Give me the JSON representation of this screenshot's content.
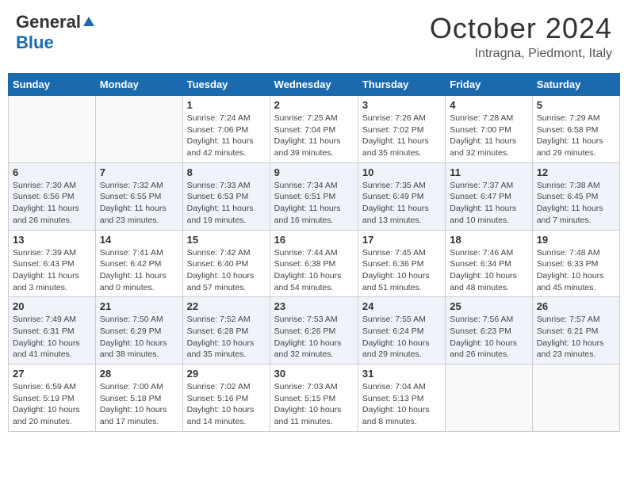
{
  "header": {
    "logo_general": "General",
    "logo_blue": "Blue",
    "month_title": "October 2024",
    "location": "Intragna, Piedmont, Italy"
  },
  "calendar": {
    "days_of_week": [
      "Sunday",
      "Monday",
      "Tuesday",
      "Wednesday",
      "Thursday",
      "Friday",
      "Saturday"
    ],
    "weeks": [
      [
        {
          "day": "",
          "info": ""
        },
        {
          "day": "",
          "info": ""
        },
        {
          "day": "1",
          "info": "Sunrise: 7:24 AM\nSunset: 7:06 PM\nDaylight: 11 hours and 42 minutes."
        },
        {
          "day": "2",
          "info": "Sunrise: 7:25 AM\nSunset: 7:04 PM\nDaylight: 11 hours and 39 minutes."
        },
        {
          "day": "3",
          "info": "Sunrise: 7:26 AM\nSunset: 7:02 PM\nDaylight: 11 hours and 35 minutes."
        },
        {
          "day": "4",
          "info": "Sunrise: 7:28 AM\nSunset: 7:00 PM\nDaylight: 11 hours and 32 minutes."
        },
        {
          "day": "5",
          "info": "Sunrise: 7:29 AM\nSunset: 6:58 PM\nDaylight: 11 hours and 29 minutes."
        }
      ],
      [
        {
          "day": "6",
          "info": "Sunrise: 7:30 AM\nSunset: 6:56 PM\nDaylight: 11 hours and 26 minutes."
        },
        {
          "day": "7",
          "info": "Sunrise: 7:32 AM\nSunset: 6:55 PM\nDaylight: 11 hours and 23 minutes."
        },
        {
          "day": "8",
          "info": "Sunrise: 7:33 AM\nSunset: 6:53 PM\nDaylight: 11 hours and 19 minutes."
        },
        {
          "day": "9",
          "info": "Sunrise: 7:34 AM\nSunset: 6:51 PM\nDaylight: 11 hours and 16 minutes."
        },
        {
          "day": "10",
          "info": "Sunrise: 7:35 AM\nSunset: 6:49 PM\nDaylight: 11 hours and 13 minutes."
        },
        {
          "day": "11",
          "info": "Sunrise: 7:37 AM\nSunset: 6:47 PM\nDaylight: 11 hours and 10 minutes."
        },
        {
          "day": "12",
          "info": "Sunrise: 7:38 AM\nSunset: 6:45 PM\nDaylight: 11 hours and 7 minutes."
        }
      ],
      [
        {
          "day": "13",
          "info": "Sunrise: 7:39 AM\nSunset: 6:43 PM\nDaylight: 11 hours and 3 minutes."
        },
        {
          "day": "14",
          "info": "Sunrise: 7:41 AM\nSunset: 6:42 PM\nDaylight: 11 hours and 0 minutes."
        },
        {
          "day": "15",
          "info": "Sunrise: 7:42 AM\nSunset: 6:40 PM\nDaylight: 10 hours and 57 minutes."
        },
        {
          "day": "16",
          "info": "Sunrise: 7:44 AM\nSunset: 6:38 PM\nDaylight: 10 hours and 54 minutes."
        },
        {
          "day": "17",
          "info": "Sunrise: 7:45 AM\nSunset: 6:36 PM\nDaylight: 10 hours and 51 minutes."
        },
        {
          "day": "18",
          "info": "Sunrise: 7:46 AM\nSunset: 6:34 PM\nDaylight: 10 hours and 48 minutes."
        },
        {
          "day": "19",
          "info": "Sunrise: 7:48 AM\nSunset: 6:33 PM\nDaylight: 10 hours and 45 minutes."
        }
      ],
      [
        {
          "day": "20",
          "info": "Sunrise: 7:49 AM\nSunset: 6:31 PM\nDaylight: 10 hours and 41 minutes."
        },
        {
          "day": "21",
          "info": "Sunrise: 7:50 AM\nSunset: 6:29 PM\nDaylight: 10 hours and 38 minutes."
        },
        {
          "day": "22",
          "info": "Sunrise: 7:52 AM\nSunset: 6:28 PM\nDaylight: 10 hours and 35 minutes."
        },
        {
          "day": "23",
          "info": "Sunrise: 7:53 AM\nSunset: 6:26 PM\nDaylight: 10 hours and 32 minutes."
        },
        {
          "day": "24",
          "info": "Sunrise: 7:55 AM\nSunset: 6:24 PM\nDaylight: 10 hours and 29 minutes."
        },
        {
          "day": "25",
          "info": "Sunrise: 7:56 AM\nSunset: 6:23 PM\nDaylight: 10 hours and 26 minutes."
        },
        {
          "day": "26",
          "info": "Sunrise: 7:57 AM\nSunset: 6:21 PM\nDaylight: 10 hours and 23 minutes."
        }
      ],
      [
        {
          "day": "27",
          "info": "Sunrise: 6:59 AM\nSunset: 5:19 PM\nDaylight: 10 hours and 20 minutes."
        },
        {
          "day": "28",
          "info": "Sunrise: 7:00 AM\nSunset: 5:18 PM\nDaylight: 10 hours and 17 minutes."
        },
        {
          "day": "29",
          "info": "Sunrise: 7:02 AM\nSunset: 5:16 PM\nDaylight: 10 hours and 14 minutes."
        },
        {
          "day": "30",
          "info": "Sunrise: 7:03 AM\nSunset: 5:15 PM\nDaylight: 10 hours and 11 minutes."
        },
        {
          "day": "31",
          "info": "Sunrise: 7:04 AM\nSunset: 5:13 PM\nDaylight: 10 hours and 8 minutes."
        },
        {
          "day": "",
          "info": ""
        },
        {
          "day": "",
          "info": ""
        }
      ]
    ]
  }
}
